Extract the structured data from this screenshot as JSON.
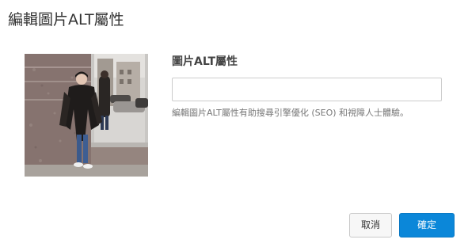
{
  "dialog": {
    "title": "編輯圖片ALT屬性"
  },
  "image": {
    "description_icon": "photo-thumbnail"
  },
  "alt_field": {
    "label": "圖片ALT屬性",
    "value": "",
    "help": "編輯圖片ALT屬性有助搜尋引擎優化 (SEO) 和視障人士體驗。"
  },
  "buttons": {
    "cancel_label": "取消",
    "confirm_label": "確定"
  },
  "colors": {
    "primary": "#0b87d9",
    "text": "#333333",
    "muted": "#777777",
    "border": "#cccccc"
  }
}
